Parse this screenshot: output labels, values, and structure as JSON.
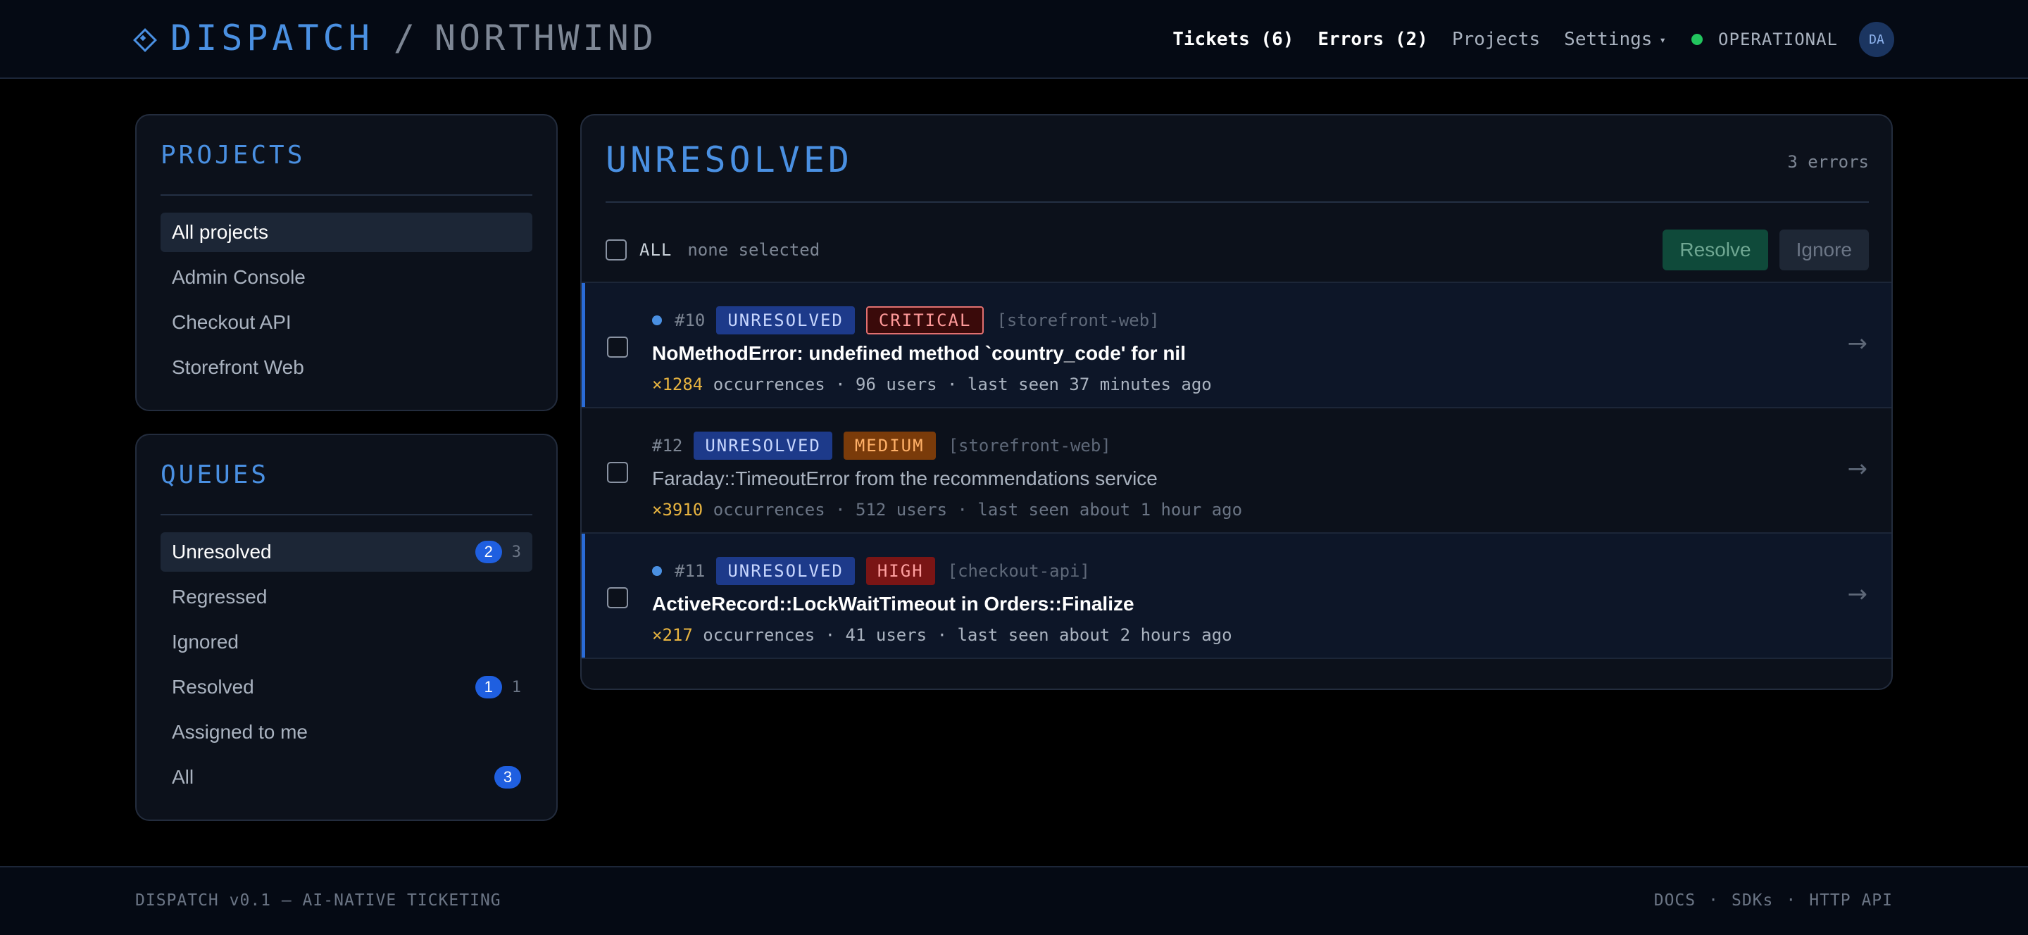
{
  "header": {
    "brand": "DISPATCH",
    "separator": "/",
    "org": "NORTHWIND",
    "nav": {
      "tickets": "Tickets (6)",
      "errors": "Errors (2)",
      "projects": "Projects",
      "settings": "Settings",
      "settings_caret": "▾"
    },
    "status": "OPERATIONAL",
    "avatar": "DA"
  },
  "sidebar": {
    "projects": {
      "title": "PROJECTS",
      "items": [
        {
          "label": "All projects"
        },
        {
          "label": "Admin Console"
        },
        {
          "label": "Checkout API"
        },
        {
          "label": "Storefront Web"
        }
      ]
    },
    "queues": {
      "title": "QUEUES",
      "items": [
        {
          "label": "Unresolved",
          "badge": "2",
          "count": "3"
        },
        {
          "label": "Regressed"
        },
        {
          "label": "Ignored"
        },
        {
          "label": "Resolved",
          "badge": "1",
          "count": "1"
        },
        {
          "label": "Assigned to me"
        },
        {
          "label": "All",
          "badge": "3"
        }
      ]
    }
  },
  "main": {
    "title": "UNRESOLVED",
    "count": "3 errors",
    "toolbar": {
      "all_label": "ALL",
      "selection": "none selected",
      "resolve": "Resolve",
      "ignore": "Ignore"
    },
    "errors": [
      {
        "number": "#10",
        "status": "UNRESOLVED",
        "severity": "CRITICAL",
        "project": "[storefront-web]",
        "title": "NoMethodError: undefined method `country_code' for nil",
        "occurrences": "×1284",
        "stats": "occurrences · 96 users · last seen 37 minutes ago",
        "arrow": "→"
      },
      {
        "number": "#12",
        "status": "UNRESOLVED",
        "severity": "MEDIUM",
        "project": "[storefront-web]",
        "title": "Faraday::TimeoutError from the recommendations service",
        "occurrences": "×3910",
        "stats": "occurrences · 512 users · last seen about 1 hour ago",
        "arrow": "→"
      },
      {
        "number": "#11",
        "status": "UNRESOLVED",
        "severity": "HIGH",
        "project": "[checkout-api]",
        "title": "ActiveRecord::LockWaitTimeout in Orders::Finalize",
        "occurrences": "×217",
        "stats": "occurrences · 41 users · last seen about 2 hours ago",
        "arrow": "→"
      }
    ]
  },
  "footer": {
    "left": "DISPATCH v0.1 — AI-NATIVE TICKETING",
    "links": [
      "DOCS",
      "SDKs",
      "HTTP API"
    ],
    "separator": "·"
  },
  "colors": {
    "accent": "#4a90e2",
    "badge": "#1f5fe0",
    "status_ok": "#22c55e",
    "occurrences": "#e8b440"
  }
}
